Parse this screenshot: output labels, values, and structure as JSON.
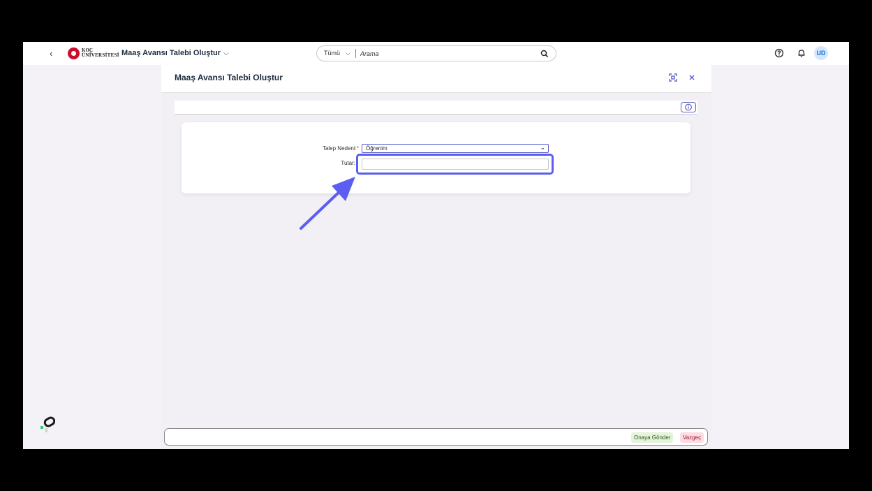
{
  "shellbar": {
    "back_icon": "chevron-left-icon",
    "logo": {
      "line1": "KOÇ",
      "line2": "ÜNİVERSİTESİ"
    },
    "app_title": "Maaş Avansı Talebi Oluştur",
    "app_title_chevron": "⌵",
    "search": {
      "scope": "Tümü",
      "scope_chevron": "⌵",
      "placeholder": "Arama"
    },
    "user_initials": "UD",
    "icons": [
      "help-icon",
      "bell-icon"
    ]
  },
  "dialog": {
    "title": "Maaş Avansı Talebi Oluştur",
    "header_icons": [
      "fullscreen-icon",
      "close-icon"
    ],
    "accent_color": "#5b5fc7"
  },
  "form": {
    "reason_label": "Talep Nedeni:",
    "reason_required": "*",
    "reason_value": "Öğrenim",
    "amount_label": "Tutar:",
    "amount_value": ""
  },
  "footer": {
    "submit_label": "Onaya Gönder",
    "cancel_label": "Vazgeç"
  },
  "annotation": {
    "highlight_color": "#5b5ef0"
  }
}
